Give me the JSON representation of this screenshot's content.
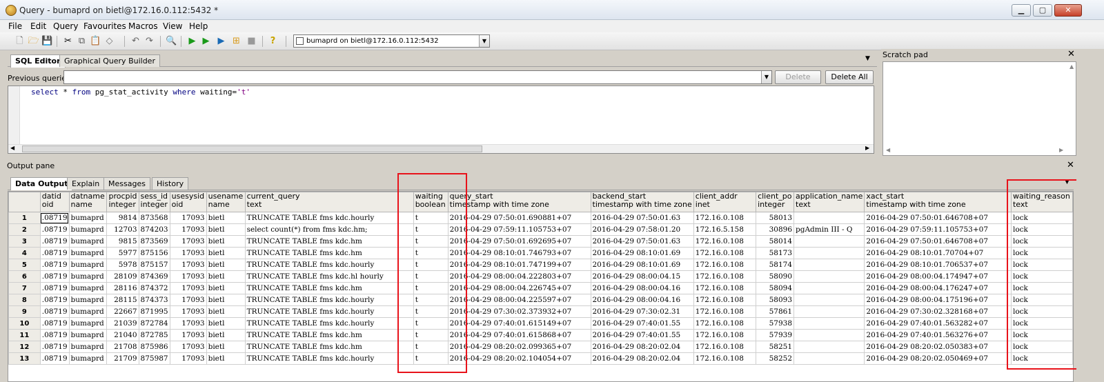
{
  "window": {
    "title": "Query - bumaprd on bietl@172.16.0.112:5432 *"
  },
  "menu": [
    "File",
    "Edit",
    "Query",
    "Favourites",
    "Macros",
    "View",
    "Help"
  ],
  "toolbar": {
    "connection": "bumaprd on bietl@172.16.0.112:5432"
  },
  "sql_tabs": [
    "SQL Editor",
    "Graphical Query Builder"
  ],
  "prev_queries_label": "Previous queries",
  "buttons": {
    "delete": "Delete",
    "delete_all": "Delete All"
  },
  "sql": {
    "kw1": "select",
    "mid1": " * ",
    "kw2": "from",
    "mid2": " pg_stat_activity ",
    "kw3": "where",
    "mid3": " waiting=",
    "str": "'t'"
  },
  "scratch": {
    "title": "Scratch pad"
  },
  "output": {
    "title": "Output pane",
    "tabs": [
      "Data Output",
      "Explain",
      "Messages",
      "History"
    ],
    "columns": [
      {
        "name": "datid",
        "type": "oid"
      },
      {
        "name": "datname",
        "type": "name"
      },
      {
        "name": "procpid",
        "type": "integer"
      },
      {
        "name": "sess_id",
        "type": "integer"
      },
      {
        "name": "usesysid",
        "type": "oid"
      },
      {
        "name": "usename",
        "type": "name"
      },
      {
        "name": "current_query",
        "type": "text"
      },
      {
        "name": "waiting",
        "type": "boolean"
      },
      {
        "name": "query_start",
        "type": "timestamp with time zone"
      },
      {
        "name": "backend_start",
        "type": "timestamp with time zone"
      },
      {
        "name": "client_addr",
        "type": "inet"
      },
      {
        "name": "client_po",
        "type": "integer"
      },
      {
        "name": "application_name",
        "type": "text"
      },
      {
        "name": "xact_start",
        "type": "timestamp with time zone"
      },
      {
        "name": "waiting_reason",
        "type": "text"
      }
    ],
    "rows": [
      [
        "1",
        ".08719",
        "bumaprd",
        "9814",
        "873568",
        "17093",
        "bietl",
        "TRUNCATE TABLE fms kdc.hourly",
        "t",
        "2016-04-29 07:50:01.690881+07",
        "2016-04-29 07:50:01.63",
        "172.16.0.108",
        "58013",
        "",
        "2016-04-29 07:50:01.646708+07",
        "lock"
      ],
      [
        "2",
        ".08719",
        "bumaprd",
        "12703",
        "874203",
        "17093",
        "bietl",
        "select count(*) from fms kdc.hm;",
        "t",
        "2016-04-29 07:59:11.105753+07",
        "2016-04-29 07:58:01.20",
        "172.16.5.158",
        "30896",
        "pgAdmin III - Q",
        "2016-04-29 07:59:11.105753+07",
        "lock"
      ],
      [
        "3",
        ".08719",
        "bumaprd",
        "9815",
        "873569",
        "17093",
        "bietl",
        "TRUNCATE TABLE fms kdc.hm",
        "t",
        "2016-04-29 07:50:01.692695+07",
        "2016-04-29 07:50:01.63",
        "172.16.0.108",
        "58014",
        "",
        "2016-04-29 07:50:01.646708+07",
        "lock"
      ],
      [
        "4",
        ".08719",
        "bumaprd",
        "5977",
        "875156",
        "17093",
        "bietl",
        "TRUNCATE TABLE fms kdc.hm",
        "t",
        "2016-04-29 08:10:01.746793+07",
        "2016-04-29 08:10:01.69",
        "172.16.0.108",
        "58173",
        "",
        "2016-04-29 08:10:01.70704+07",
        "lock"
      ],
      [
        "5",
        ".08719",
        "bumaprd",
        "5978",
        "875157",
        "17093",
        "bietl",
        "TRUNCATE TABLE fms kdc.hourly",
        "t",
        "2016-04-29 08:10:01.747199+07",
        "2016-04-29 08:10:01.69",
        "172.16.0.108",
        "58174",
        "",
        "2016-04-29 08:10:01.706537+07",
        "lock"
      ],
      [
        "6",
        ".08719",
        "bumaprd",
        "28109",
        "874369",
        "17093",
        "bietl",
        "TRUNCATE TABLE fms kdc.hl hourly",
        "t",
        "2016-04-29 08:00:04.222803+07",
        "2016-04-29 08:00:04.15",
        "172.16.0.108",
        "58090",
        "",
        "2016-04-29 08:00:04.174947+07",
        "lock"
      ],
      [
        "7",
        ".08719",
        "bumaprd",
        "28116",
        "874372",
        "17093",
        "bietl",
        "TRUNCATE TABLE fms kdc.hm",
        "t",
        "2016-04-29 08:00:04.226745+07",
        "2016-04-29 08:00:04.16",
        "172.16.0.108",
        "58094",
        "",
        "2016-04-29 08:00:04.176247+07",
        "lock"
      ],
      [
        "8",
        ".08719",
        "bumaprd",
        "28115",
        "874373",
        "17093",
        "bietl",
        "TRUNCATE TABLE fms kdc.hourly",
        "t",
        "2016-04-29 08:00:04.225597+07",
        "2016-04-29 08:00:04.16",
        "172.16.0.108",
        "58093",
        "",
        "2016-04-29 08:00:04.175196+07",
        "lock"
      ],
      [
        "9",
        ".08719",
        "bumaprd",
        "22667",
        "871995",
        "17093",
        "bietl",
        "TRUNCATE TABLE fms kdc.hourly",
        "t",
        "2016-04-29 07:30:02.373932+07",
        "2016-04-29 07:30:02.31",
        "172.16.0.108",
        "57861",
        "",
        "2016-04-29 07:30:02.328168+07",
        "lock"
      ],
      [
        "10",
        ".08719",
        "bumaprd",
        "21039",
        "872784",
        "17093",
        "bietl",
        "TRUNCATE TABLE fms kdc.hourly",
        "t",
        "2016-04-29 07:40:01.615149+07",
        "2016-04-29 07:40:01.55",
        "172.16.0.108",
        "57938",
        "",
        "2016-04-29 07:40:01.563282+07",
        "lock"
      ],
      [
        "11",
        ".08719",
        "bumaprd",
        "21040",
        "872785",
        "17093",
        "bietl",
        "TRUNCATE TABLE fms kdc.hm",
        "t",
        "2016-04-29 07:40:01.615868+07",
        "2016-04-29 07:40:01.55",
        "172.16.0.108",
        "57939",
        "",
        "2016-04-29 07:40:01.563276+07",
        "lock"
      ],
      [
        "12",
        ".08719",
        "bumaprd",
        "21708",
        "875986",
        "17093",
        "bietl",
        "TRUNCATE TABLE fms kdc.hm",
        "t",
        "2016-04-29 08:20:02.099365+07",
        "2016-04-29 08:20:02.04",
        "172.16.0.108",
        "58251",
        "",
        "2016-04-29 08:20:02.050383+07",
        "lock"
      ],
      [
        "13",
        ".08719",
        "bumaprd",
        "21709",
        "875987",
        "17093",
        "bietl",
        "TRUNCATE TABLE fms kdc.hourly",
        "t",
        "2016-04-29 08:20:02.104054+07",
        "2016-04-29 08:20:02.04",
        "172.16.0.108",
        "58252",
        "",
        "2016-04-29 08:20:02.050469+07",
        "lock"
      ]
    ]
  },
  "colors": {
    "highlight": "#e8121a"
  }
}
